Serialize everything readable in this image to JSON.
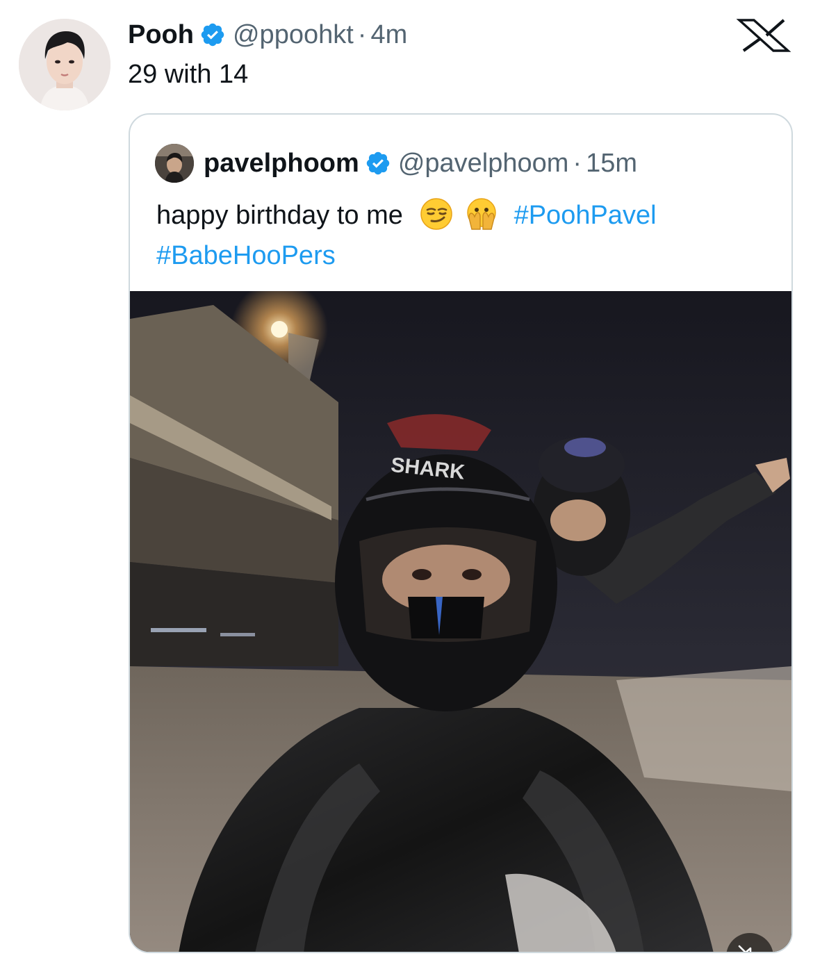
{
  "tweet": {
    "author": {
      "display_name": "Pooh",
      "handle": "@ppoohkt",
      "time": "4m",
      "separator": "·",
      "verified": true,
      "avatar_icon": "profile-photo"
    },
    "text": "29 with 14",
    "platform_logo": "x-logo"
  },
  "quoted_tweet": {
    "author": {
      "display_name": "pavelphoom",
      "handle": "@pavelphoom",
      "time": "15m",
      "separator": "·",
      "verified": true,
      "avatar_icon": "profile-photo"
    },
    "text": "happy birthday to me",
    "emojis": [
      "smirking-face",
      "face-with-open-eyes-and-hand-over-mouth"
    ],
    "hashtags": [
      "#PoohPavel",
      "#BabeHooPers"
    ],
    "media": {
      "type": "video",
      "description_icon": "video-thumbnail",
      "helmet_brand_text": "SHARK",
      "muted": true,
      "mute_icon": "speaker-muted-icon"
    }
  },
  "colors": {
    "verified_badge": "#1d9bf0",
    "hashtag": "#1d9bf0",
    "secondary_text": "#536471",
    "primary_text": "#0f1419",
    "card_border": "#cfd9de"
  }
}
